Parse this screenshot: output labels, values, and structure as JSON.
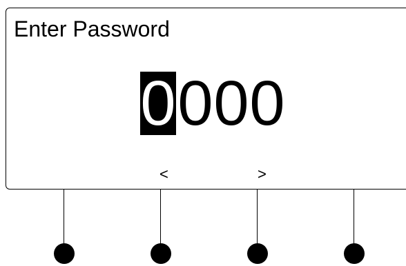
{
  "screen": {
    "title": "Enter Password",
    "password_digits": [
      "0",
      "0",
      "0",
      "0"
    ],
    "selected_digit_index": 0,
    "nav_prev_label": "<",
    "nav_next_label": ">"
  },
  "keys": [
    {
      "name": "softkey-1"
    },
    {
      "name": "softkey-2"
    },
    {
      "name": "softkey-3"
    },
    {
      "name": "softkey-4"
    }
  ]
}
